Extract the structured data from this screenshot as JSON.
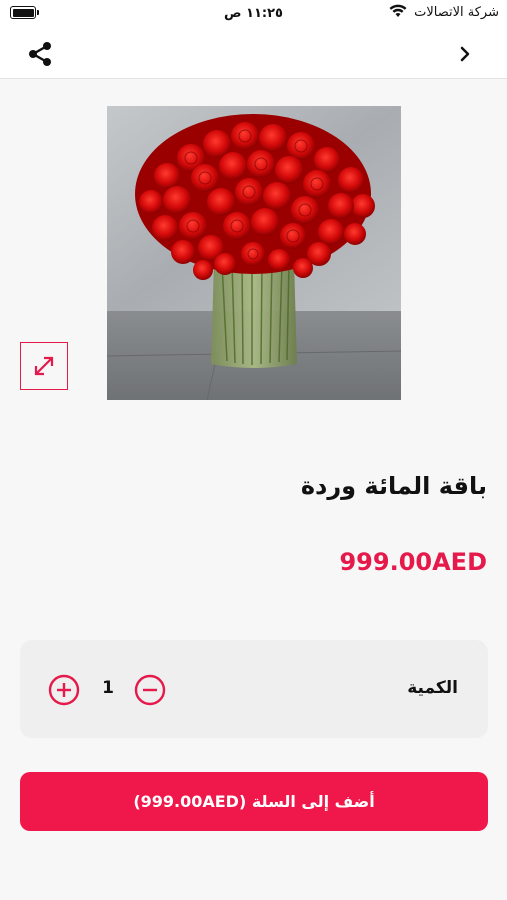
{
  "status_bar": {
    "carrier": "شركة الاتصالات",
    "time": "١١:٢٥ ص"
  },
  "nav": {
    "share_icon": "share-icon",
    "back_icon": "chevron-right-icon"
  },
  "product": {
    "image_alt": "red-roses-bouquet-in-glass-vase",
    "title": "باقة المائة وردة",
    "price": "999.00AED"
  },
  "quantity": {
    "label": "الكمية",
    "value": "1"
  },
  "cart_button": {
    "label": "أضف إلى السلة (999.00AED)"
  },
  "colors": {
    "accent": "#f0184b",
    "background": "#f7f7f7",
    "card": "#efefef"
  }
}
